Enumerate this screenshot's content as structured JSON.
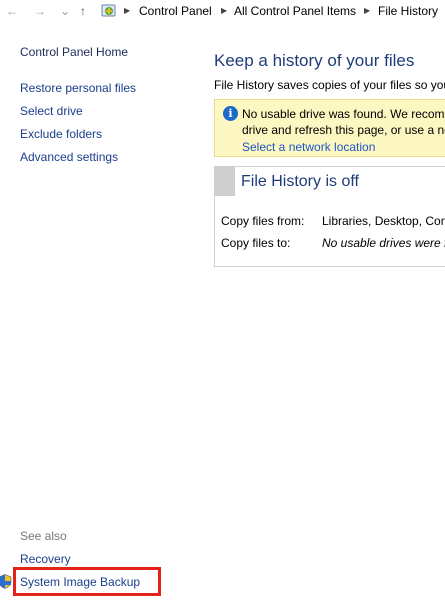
{
  "address_bar": {
    "back_icon": "←",
    "forward_icon": "→",
    "recent_icon": "⌄",
    "up_icon": "↑",
    "location_icon": "control-panel-icon",
    "separator": "▶",
    "crumbs": [
      "Control Panel",
      "All Control Panel Items",
      "File History"
    ]
  },
  "sidebar": {
    "home": "Control Panel Home",
    "links": [
      "Restore personal files",
      "Select drive",
      "Exclude folders",
      "Advanced settings"
    ],
    "see_also_label": "See also",
    "see_also": [
      "Recovery",
      "System Image Backup"
    ],
    "highlight_color": "#e2231a"
  },
  "main": {
    "title": "Keep a history of your files",
    "description": "File History saves copies of your files so you",
    "warning": {
      "icon": "i",
      "line1": "No usable drive was found. We recomm",
      "line2": "drive and refresh this page, or use a ne",
      "link": "Select a network location"
    },
    "status": {
      "title": "File History is off",
      "copy_from_label": "Copy files from:",
      "copy_from_value": "Libraries, Desktop, Cont",
      "copy_to_label": "Copy files to:",
      "copy_to_value": "No usable drives were fo"
    }
  },
  "colors": {
    "link": "#1a3e8c",
    "heading": "#1e3c78",
    "warning_bg": "#fdf7c2",
    "info_blue": "#1b6ac9"
  }
}
